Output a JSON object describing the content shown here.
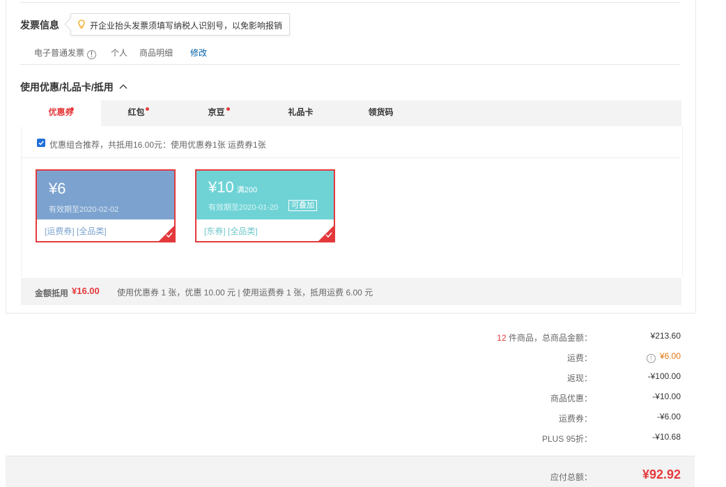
{
  "invoice": {
    "title": "发票信息",
    "tooltip": "开企业抬头发票须填写纳税人识别号，以免影响报销",
    "type": "电子普通发票",
    "info_glyph": "!",
    "holder": "个人",
    "content": "商品明细",
    "edit": "修改"
  },
  "discount": {
    "title": "使用优惠/礼品卡/抵用",
    "tabs": [
      {
        "label": "优惠券",
        "dot": true
      },
      {
        "label": "红包",
        "dot": true
      },
      {
        "label": "京豆",
        "dot": true
      },
      {
        "label": "礼品卡",
        "dot": false
      },
      {
        "label": "领货码",
        "dot": false
      }
    ],
    "recommend_text": "优惠组合推荐，共抵用16.00元：使用优惠券1张 运费券1张",
    "coupons": [
      {
        "amount": "¥6",
        "condition": "",
        "expiry": "有效期至2020-02-02",
        "tags": "[运费券] [全品类]",
        "badge": "",
        "color": "#7ca3cf"
      },
      {
        "amount": "¥10",
        "condition": "满200",
        "expiry": "有效期至2020-01-20",
        "tags": "[东券] [全品类]",
        "badge": "可叠加",
        "color": "#6fd3d6"
      }
    ],
    "summary_label": "金额抵用",
    "summary_amount": "¥16.00",
    "summary_detail": "使用优惠券 1 张，优惠 10.00 元  | 使用运费券 1 张，抵用运费 6.00 元"
  },
  "totals": {
    "count": "12",
    "count_suffix": " 件商品，总商品金额：",
    "goods_amount": "¥213.60",
    "freight_label": "运费：",
    "freight_value": "¥6.00",
    "cashback_label": "返现：",
    "cashback_value": "-¥100.00",
    "product_discount_label": "商品优惠：",
    "product_discount_value": "-¥10.00",
    "freight_coupon_label": "运费券：",
    "freight_coupon_value": "-¥6.00",
    "plus_label": "PLUS 95折：",
    "plus_value": "-¥10.68",
    "payable_label": "应付总额：",
    "payable_value": "¥92.92"
  },
  "colors": {
    "accent": "#e4393c",
    "link": "#005ea7",
    "orange": "#e4720c"
  }
}
